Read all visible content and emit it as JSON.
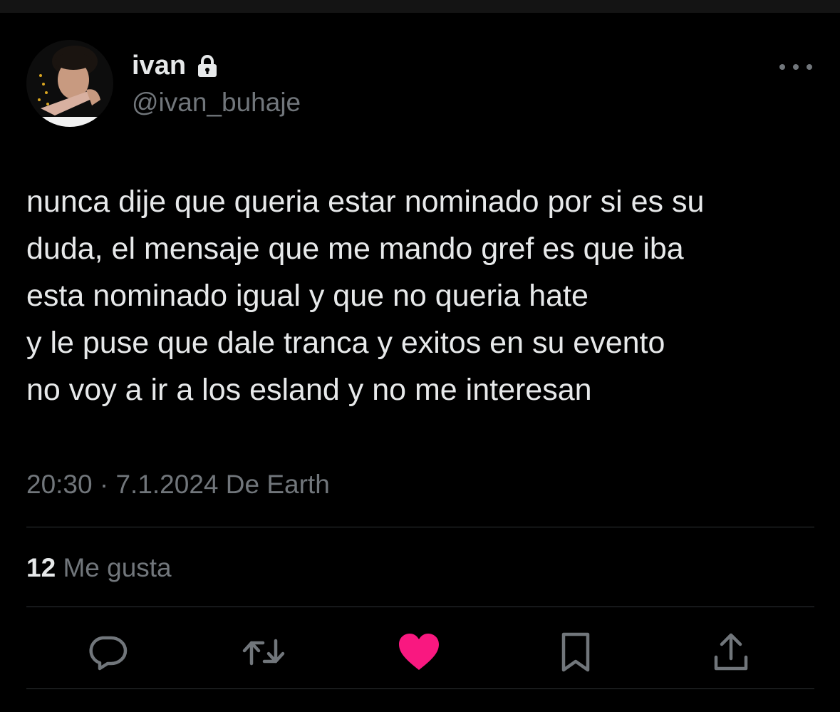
{
  "user": {
    "display_name": "ivan",
    "handle": "@ivan_buhaje",
    "avatar_icon": "profile-photo",
    "lock_icon": "lock-icon"
  },
  "tweet": {
    "lines": [
      "nunca dije que queria estar nominado por si es su",
      "duda, el mensaje que me mando gref es que iba",
      "esta nominado igual y que no queria hate",
      "y le puse que dale tranca y exitos en su evento",
      "no voy a ir a los esland y no me interesan"
    ],
    "meta": "20:30 · 7.1.2024 De Earth"
  },
  "stats": {
    "likes_count": "12",
    "likes_label": "Me gusta"
  },
  "actions": [
    {
      "name": "reply",
      "icon": "reply-icon"
    },
    {
      "name": "retweet",
      "icon": "retweet-icon"
    },
    {
      "name": "like",
      "icon": "heart-icon",
      "active": true
    },
    {
      "name": "bookmark",
      "icon": "bookmark-icon"
    },
    {
      "name": "share",
      "icon": "share-icon"
    }
  ],
  "colors": {
    "background": "#000000",
    "text": "#e7e9ea",
    "muted": "#71767b",
    "divider": "#2f3336",
    "like_active": "#f91880"
  }
}
